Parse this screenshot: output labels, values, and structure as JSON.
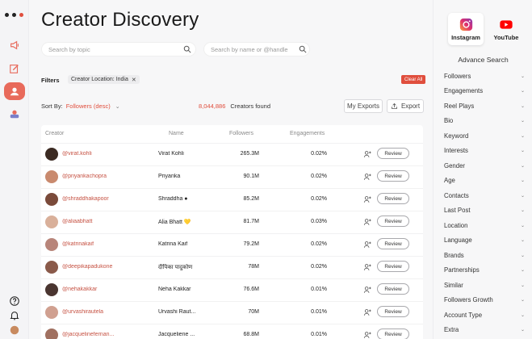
{
  "page": {
    "title": "Creator Discovery"
  },
  "search": {
    "topic_placeholder": "Search by topic",
    "name_placeholder": "Search by name or @handle"
  },
  "filters": {
    "label": "Filters",
    "chip_key": "Creator Location:",
    "chip_value": "India",
    "clear_label": "Clear All"
  },
  "sort": {
    "label": "Sort By:",
    "value": "Followers (desc)",
    "found_count": "8,044,886",
    "found_label": "Creators found"
  },
  "actions": {
    "my_exports": "My Exports",
    "export": "Export"
  },
  "table": {
    "headers": {
      "creator": "Creator",
      "name": "Name",
      "followers": "Followers",
      "engagements": "Engagements"
    },
    "review_label": "Review",
    "rows": [
      {
        "handle": "@virat.kohli",
        "name": "Virat Kohli",
        "followers": "265.3M",
        "engagements": "0.02%"
      },
      {
        "handle": "@priyankachopra",
        "name": "Priyanka",
        "followers": "90.1M",
        "engagements": "0.02%"
      },
      {
        "handle": "@shraddhakapoor",
        "name": "Shraddha ●",
        "followers": "85.2M",
        "engagements": "0.02%"
      },
      {
        "handle": "@aliaabhatt",
        "name": "Alia Bhatt 💛",
        "followers": "81.7M",
        "engagements": "0.03%"
      },
      {
        "handle": "@katrinakaif",
        "name": "Katrina Kaif",
        "followers": "79.2M",
        "engagements": "0.02%"
      },
      {
        "handle": "@deepikapadukone",
        "name": "दीपिका पादुकोण",
        "followers": "78M",
        "engagements": "0.02%"
      },
      {
        "handle": "@nehakakkar",
        "name": "Neha Kakkar",
        "followers": "76.6M",
        "engagements": "0.01%"
      },
      {
        "handle": "@urvashirautela",
        "name": "Urvashi Raut...",
        "followers": "70M",
        "engagements": "0.01%"
      },
      {
        "handle": "@jacquelinefernan...",
        "name": "Jacqueliene ...",
        "followers": "68.8M",
        "engagements": "0.01%"
      }
    ]
  },
  "platforms": {
    "instagram": "Instagram",
    "youtube": "YouTube"
  },
  "advance_search": {
    "title": "Advance Search",
    "items": [
      "Followers",
      "Engagements",
      "Reel Plays",
      "Bio",
      "Keyword",
      "Interests",
      "Gender",
      "Age",
      "Contacts",
      "Last Post",
      "Location",
      "Language",
      "Brands",
      "Partnerships",
      "Similar",
      "Followers Growth",
      "Account Type",
      "Extra"
    ]
  },
  "colors": {
    "accent": "#e04e3d",
    "handle": "#c65243",
    "rail_active": "#e86a5b"
  }
}
